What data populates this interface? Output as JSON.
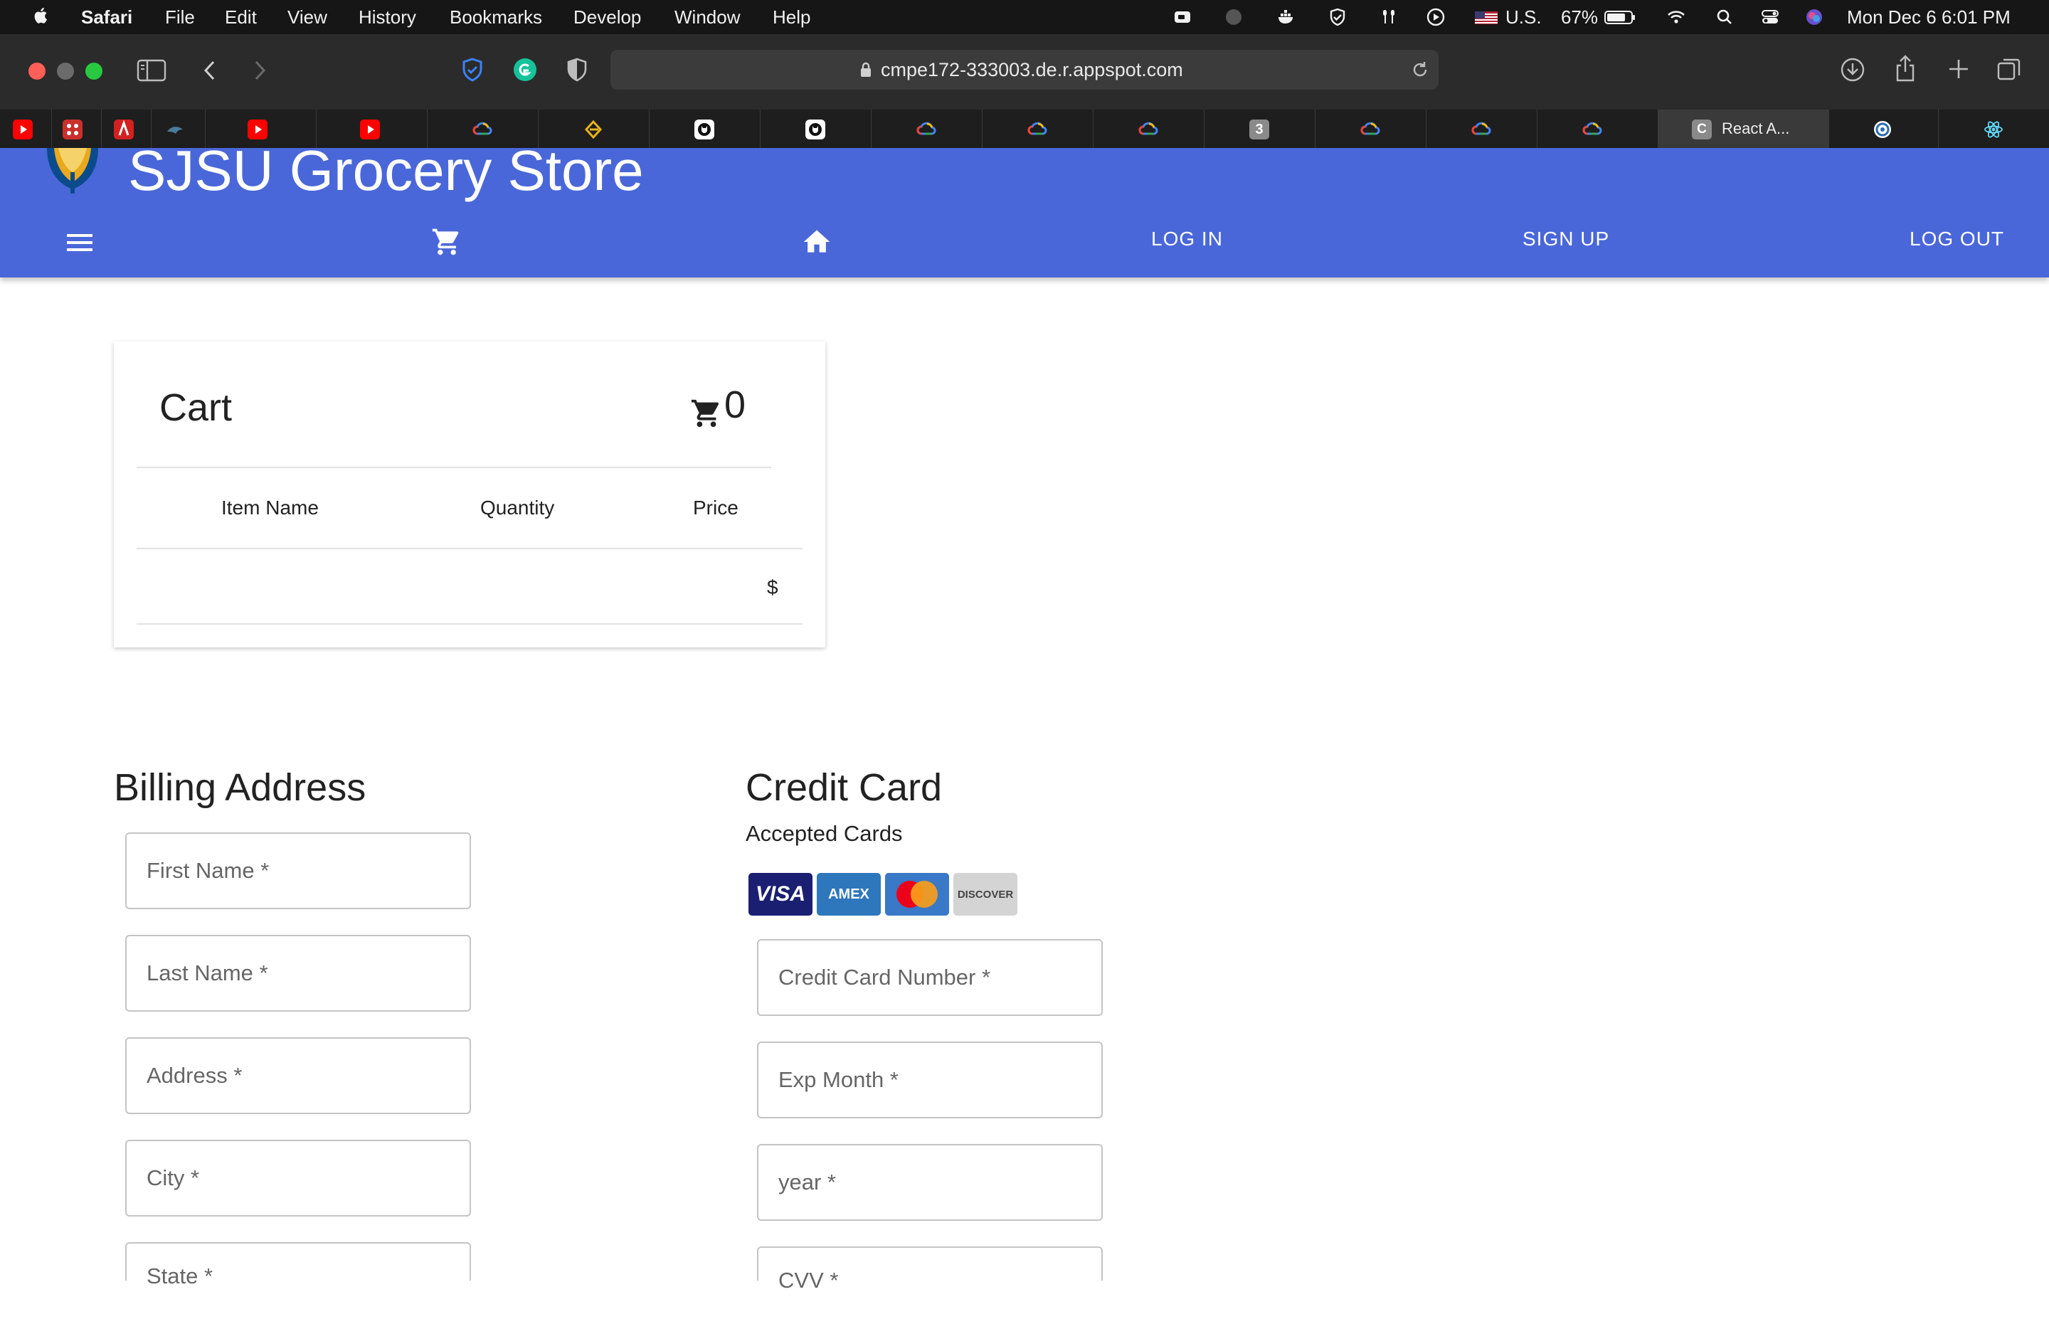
{
  "menubar": {
    "apple": "",
    "app": "Safari",
    "items": [
      "File",
      "Edit",
      "View",
      "History",
      "Bookmarks",
      "Develop",
      "Window",
      "Help"
    ],
    "input_source": "U.S.",
    "battery": "67%",
    "datetime": "Mon Dec 6  6:01 PM"
  },
  "browser": {
    "url": "cmpe172-333003.de.r.appspot.com",
    "active_tab_label": "React A...",
    "active_tab_letter": "C",
    "badge_tab": "3"
  },
  "app": {
    "title": "SJSU Grocery Store",
    "nav": {
      "login": "LOG IN",
      "signup": "SIGN UP",
      "logout": "LOG OUT"
    }
  },
  "cart": {
    "title": "Cart",
    "count": "0",
    "columns": [
      "Item Name",
      "Quantity",
      "Price"
    ],
    "total_symbol": "$"
  },
  "billing": {
    "heading": "Billing Address",
    "fields": [
      "First Name *",
      "Last Name *",
      "Address *",
      "City *",
      "State *"
    ]
  },
  "credit": {
    "heading": "Credit Card",
    "accepted": "Accepted Cards",
    "cards": [
      "VISA",
      "AMEX",
      "",
      "DISCOVER"
    ],
    "fields": [
      "Credit Card Number *",
      "Exp Month *",
      "year *",
      "CVV *"
    ]
  },
  "colors": {
    "appbar": "#4a67d9",
    "menubar": "#161616",
    "toolbar": "#2b2b2b",
    "visa": "#1a1f71",
    "amex": "#2e77bc",
    "mastercard_red": "#eb001b",
    "mastercard_orange": "#f79e1b"
  }
}
